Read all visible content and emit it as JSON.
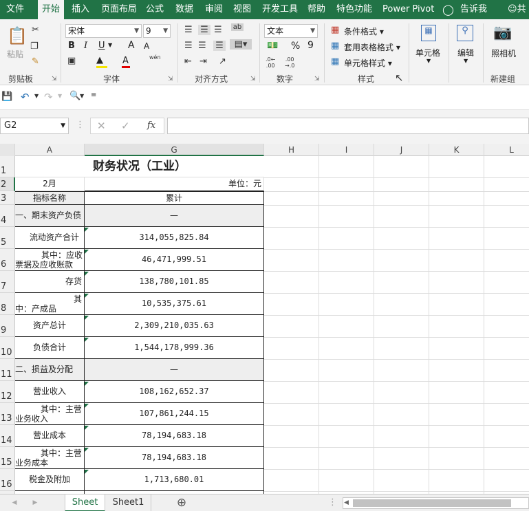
{
  "ribbon_tabs": [
    "文件",
    "开始",
    "插入",
    "页面布局",
    "公式",
    "数据",
    "审阅",
    "视图",
    "开发工具",
    "帮助",
    "特色功能",
    "Power Pivot",
    "告诉我",
    "共"
  ],
  "ribbon": {
    "paste": "粘贴",
    "font_name": "宋体",
    "font_size": "9",
    "number_format": "文本",
    "bold": "B",
    "italic": "I",
    "underline": "U",
    "grow_font": "A",
    "shrink_font": "A",
    "percent": "%",
    "comma": "9",
    "pinyin": "wén",
    "cond_format": "条件格式",
    "table_format": "套用表格格式",
    "cell_style": "单元格样式",
    "cells": "单元格",
    "edit": "编辑",
    "camera": "照相机",
    "groups": {
      "clipboard": "剪贴板",
      "font": "字体",
      "align": "对齐方式",
      "number": "数字",
      "styles": "样式",
      "newgroup": "新建组"
    }
  },
  "namebox": "G2",
  "columns": [
    "A",
    "G",
    "H",
    "I",
    "J",
    "K",
    "L"
  ],
  "rows": [
    "1",
    "2",
    "3",
    "4",
    "5",
    "6",
    "7",
    "8",
    "9",
    "10",
    "11",
    "12",
    "13",
    "14",
    "15",
    "16"
  ],
  "sheet": {
    "title": "财务状况（工业）",
    "month": "2月",
    "unit": "单位：元",
    "header_a": "指标名称",
    "header_g": "累计",
    "section1": "一、期末资产负债",
    "section2": "二、损益及分配",
    "dash": "—",
    "items": [
      {
        "name": "流动资产合计",
        "value": "314,055,825.84"
      },
      {
        "name1": "其中：应收",
        "name2": "票据及应收账款",
        "value": "46,471,999.51"
      },
      {
        "name": "存货",
        "value": "138,780,101.85"
      },
      {
        "name1": "其",
        "name2": "中：产成品",
        "value": "10,535,375.61"
      },
      {
        "name": "资产总计",
        "value": "2,309,210,035.63"
      },
      {
        "name": "负债合计",
        "value": "1,544,178,999.36"
      },
      {
        "name": "营业收入",
        "value": "108,162,652.37"
      },
      {
        "name1": "其中：主营",
        "name2": "业务收入",
        "value": "107,861,244.15"
      },
      {
        "name": "营业成本",
        "value": "78,194,683.18"
      },
      {
        "name1": "其中：主营",
        "name2": "业务成本",
        "value": "78,194,683.18"
      },
      {
        "name": "税金及附加",
        "value": "1,713,680.01"
      }
    ]
  },
  "sheet_tabs": [
    "Sheet",
    "Sheet1"
  ],
  "colors": {
    "brand": "#217346",
    "selected_fill": "#eeeeee"
  }
}
